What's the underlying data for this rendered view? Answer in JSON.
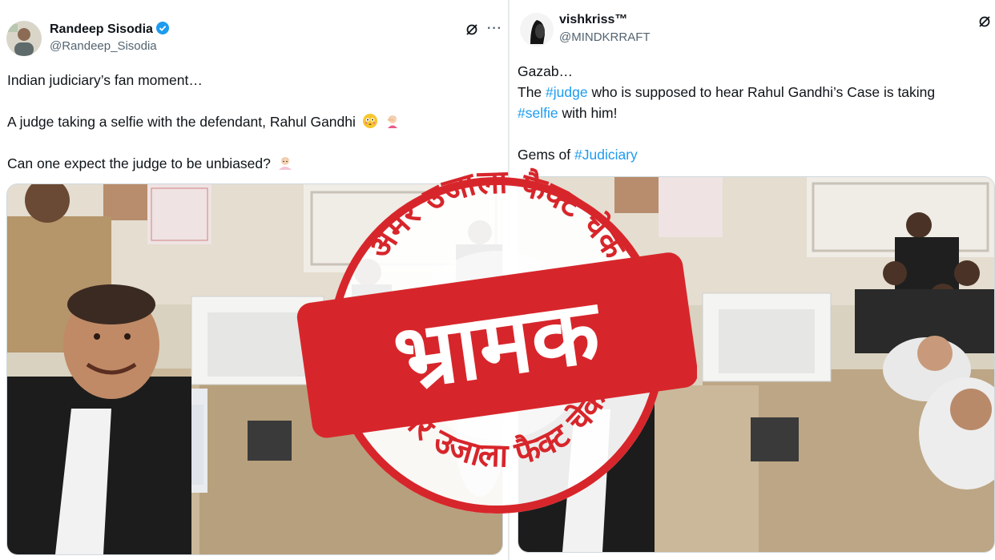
{
  "left_tweet": {
    "author_name": "Randeep Sisodia",
    "handle": "@Randeep_Sisodia",
    "verified_icon": "verified-badge-icon",
    "line1": "Indian judiciary’s fan moment…",
    "line2": "A judge taking a selfie with the defendant, Rahul Gandhi",
    "line3": "Can one expect the judge to be unbiased?",
    "more_label": "···"
  },
  "right_tweet": {
    "author_name": "vishkriss™",
    "handle": "@MINDKRRAFT",
    "line1": "Gazab…",
    "line2_pre": "The ",
    "line2_tag": "#judge",
    "line2_post": " who is supposed to hear Rahul Gandhi’s Case is taking",
    "line3_tag": "#selfie",
    "line3_post": " with him!",
    "line4_pre": "Gems of ",
    "line4_tag": "#Judiciary"
  },
  "stamp": {
    "verdict": "भ्रामक",
    "ring_text": "अमर उजाला फैक्ट चेक",
    "color": "#d7262b"
  },
  "colors": {
    "link": "#1d9bf0",
    "verified": "#1d9bf0",
    "secondary_text": "#536471"
  }
}
